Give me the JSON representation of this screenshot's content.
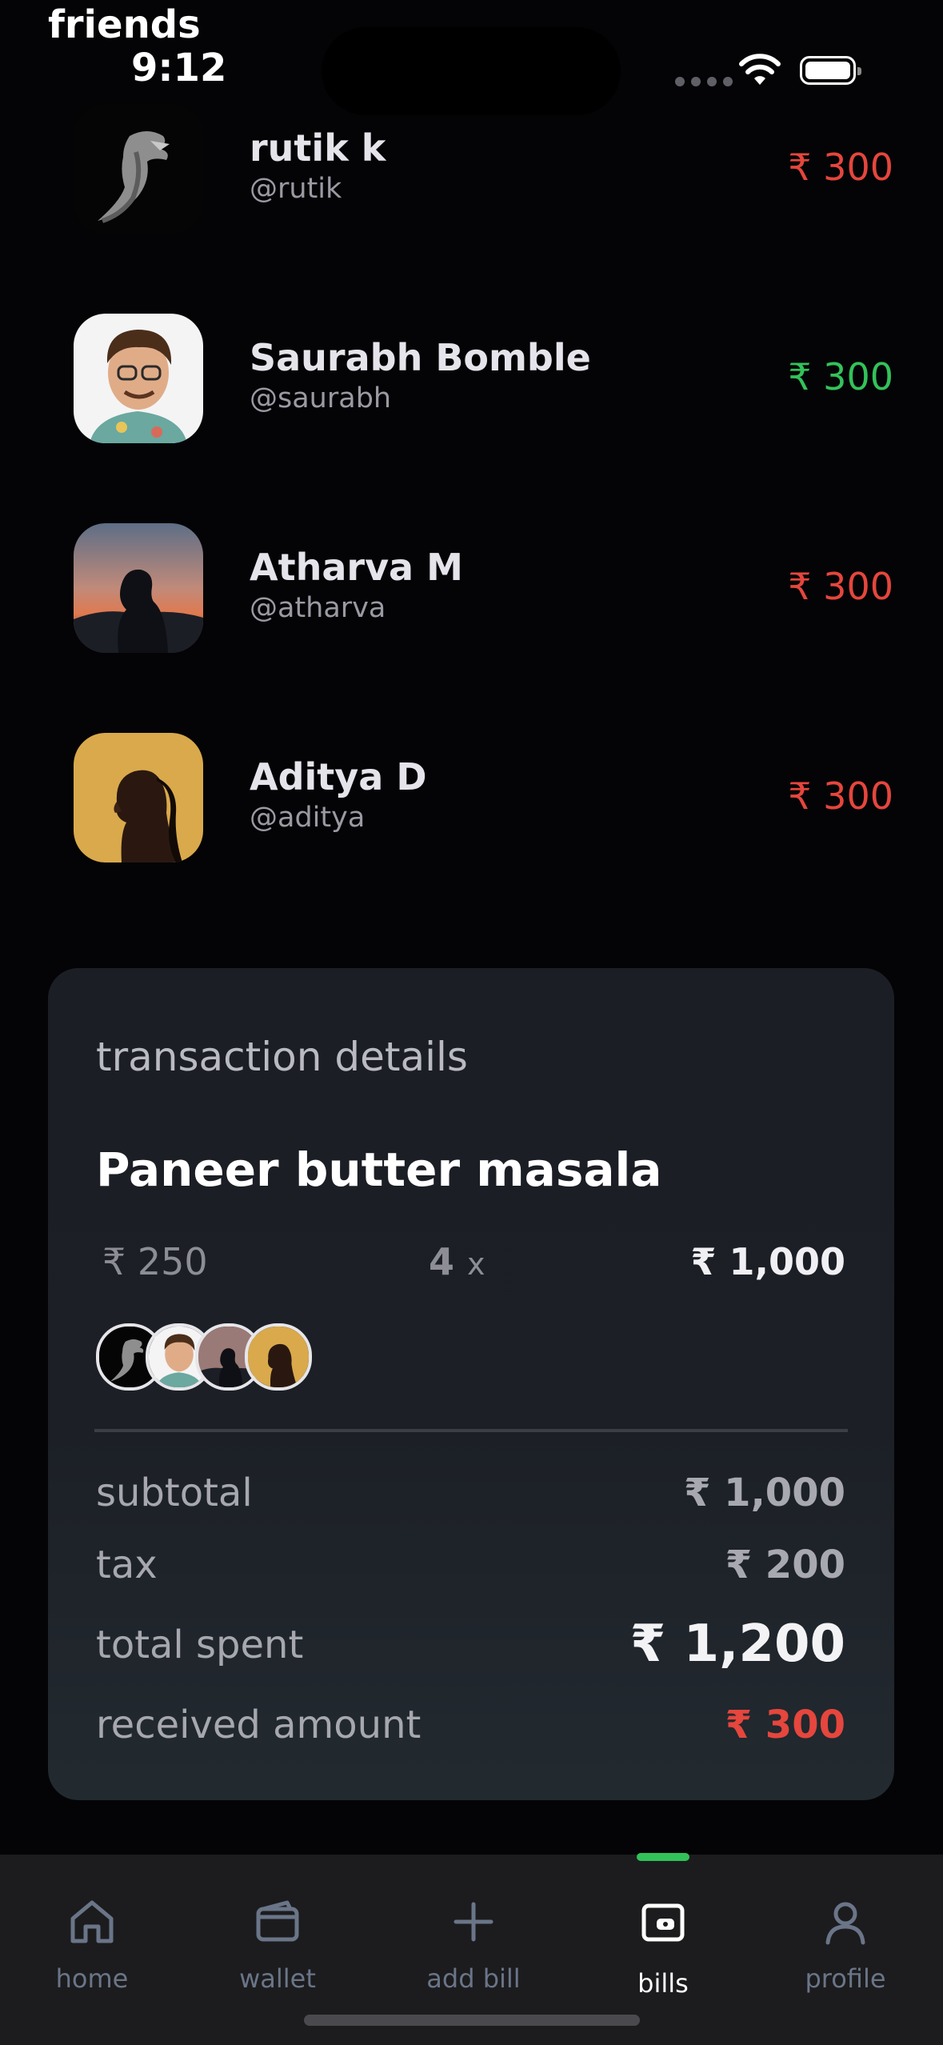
{
  "status_bar": {
    "app_label": "friends",
    "time": "9:12"
  },
  "friends": [
    {
      "name": "rutik k",
      "handle": "@rutik",
      "amount": "₹ 300",
      "status": "owed",
      "color": "#e5463d",
      "avatar": "eagle"
    },
    {
      "name": "Saurabh Bomble",
      "handle": "@saurabh",
      "amount": "₹ 300",
      "status": "paid",
      "color": "#33c25a",
      "avatar": "curly-hair-man"
    },
    {
      "name": "Atharva M",
      "handle": "@atharva",
      "amount": "₹ 300",
      "status": "owed",
      "color": "#e5463d",
      "avatar": "silhouette-sunset"
    },
    {
      "name": "Aditya D",
      "handle": "@aditya",
      "amount": "₹ 300",
      "status": "owed",
      "color": "#e5463d",
      "avatar": "woman-profile-gold"
    }
  ],
  "transaction": {
    "section_title": "transaction details",
    "item_name": "Paneer butter masala",
    "unit_price": "₹ 250",
    "quantity": "4",
    "quantity_suffix": "x",
    "line_total": "₹ 1,000",
    "summary": {
      "subtotal_label": "subtotal",
      "subtotal_value": "₹ 1,000",
      "tax_label": "tax",
      "tax_value": "₹ 200",
      "total_label": "total spent",
      "total_value": "₹ 1,200",
      "received_label": "received amount",
      "received_value": "₹ 300"
    }
  },
  "tabbar": {
    "items": [
      {
        "label": "home",
        "icon": "home-icon"
      },
      {
        "label": "wallet",
        "icon": "wallet-icon"
      },
      {
        "label": "add bill",
        "icon": "plus-icon"
      },
      {
        "label": "bills",
        "icon": "bills-icon",
        "active": true
      },
      {
        "label": "profile",
        "icon": "profile-icon"
      }
    ],
    "active_color": "#32c25a"
  }
}
